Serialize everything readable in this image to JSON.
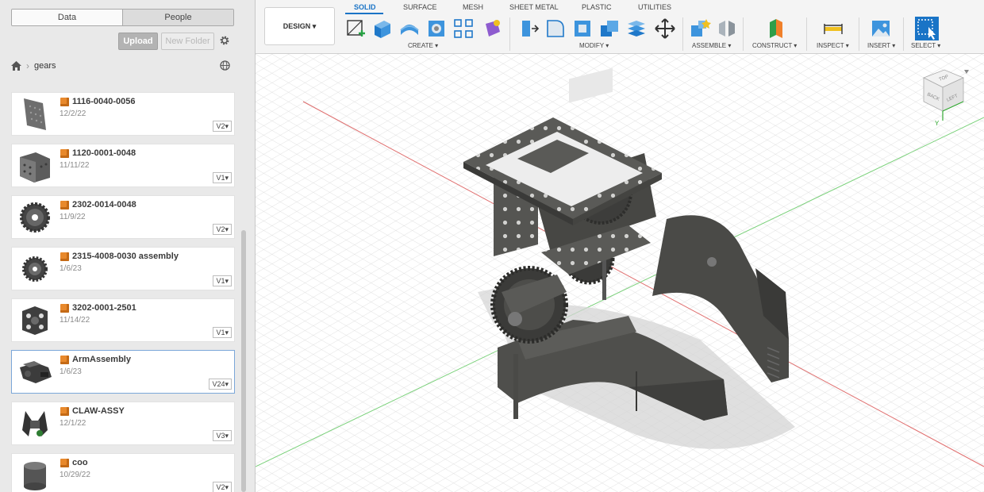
{
  "panel": {
    "tabs": [
      "Data",
      "People"
    ],
    "upload_label": "Upload",
    "new_folder_label": "New Folder",
    "breadcrumb": "gears",
    "files": [
      {
        "name": "1116-0040-0056",
        "date": "12/2/22",
        "version": "V2"
      },
      {
        "name": "1120-0001-0048",
        "date": "11/11/22",
        "version": "V1"
      },
      {
        "name": "2302-0014-0048",
        "date": "11/9/22",
        "version": "V2"
      },
      {
        "name": "2315-4008-0030 assembly",
        "date": "1/6/23",
        "version": "V1"
      },
      {
        "name": "3202-0001-2501",
        "date": "11/14/22",
        "version": "V1"
      },
      {
        "name": "ArmAssembly",
        "date": "1/6/23",
        "version": "V24",
        "selected": true
      },
      {
        "name": "CLAW-ASSY",
        "date": "12/1/22",
        "version": "V3"
      },
      {
        "name": "coo",
        "date": "10/29/22",
        "version": "V2"
      }
    ]
  },
  "toolbar": {
    "workspace": "DESIGN",
    "tabs": [
      "SOLID",
      "SURFACE",
      "MESH",
      "SHEET METAL",
      "PLASTIC",
      "UTILITIES"
    ],
    "groups": {
      "create": "CREATE",
      "modify": "MODIFY",
      "assemble": "ASSEMBLE",
      "construct": "CONSTRUCT",
      "inspect": "INSPECT",
      "insert": "INSERT",
      "select": "SELECT"
    }
  },
  "viewcube": {
    "top": "TOP",
    "back": "BACK",
    "left": "LEFT",
    "axis": "Y"
  },
  "colors": {
    "accent": "#1a74c6",
    "x_axis": "#e07070",
    "y_axis": "#7bd17b",
    "model": "#4a4a47"
  }
}
